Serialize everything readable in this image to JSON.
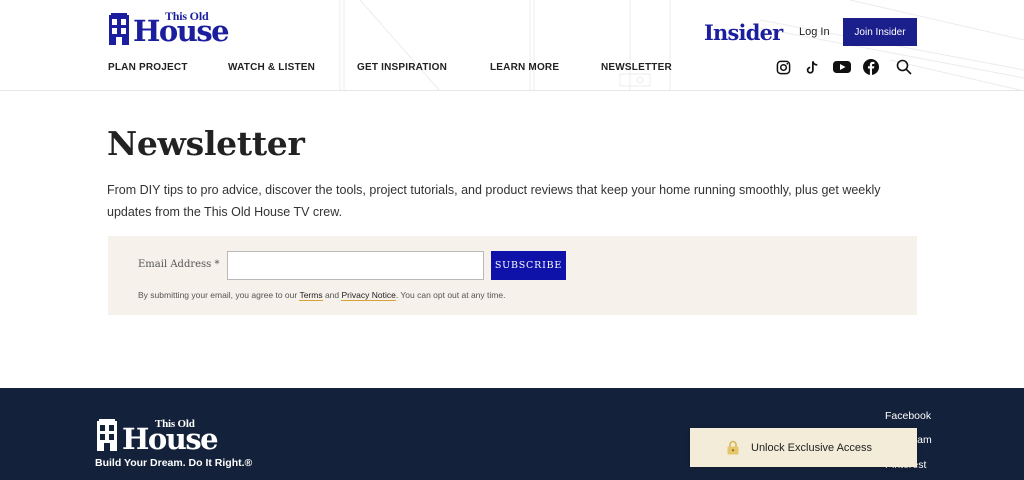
{
  "brand": {
    "logo_small": "This Old",
    "logo_big": "House",
    "insider": "Insider"
  },
  "header": {
    "login_label": "Log In",
    "join_label": "Join Insider"
  },
  "nav": {
    "items": [
      {
        "label": "PLAN PROJECT"
      },
      {
        "label": "WATCH & LISTEN"
      },
      {
        "label": "GET INSPIRATION"
      },
      {
        "label": "LEARN MORE"
      },
      {
        "label": "NEWSLETTER"
      }
    ]
  },
  "social_icons": [
    "instagram-icon",
    "tiktok-icon",
    "youtube-icon",
    "facebook-icon",
    "search-icon"
  ],
  "main": {
    "title": "Newsletter",
    "intro": "From DIY tips to pro advice, discover the tools, project tutorials, and product reviews that keep your home running smoothly, plus get weekly updates from the This Old House TV crew."
  },
  "form": {
    "email_label": "Email Address *",
    "email_value": "",
    "subscribe_label": "SUBSCRIBE",
    "disclaimer_prefix": "By submitting your email, you agree to our ",
    "terms_label": "Terms",
    "and_text": " and ",
    "privacy_label": "Privacy Notice",
    "disclaimer_suffix": ". You can opt out at any time."
  },
  "footer": {
    "tagline": "Build Your Dream. Do It Right.®",
    "links": [
      {
        "label": "Facebook"
      },
      {
        "label": "Instagram"
      },
      {
        "label": "Pinterest"
      }
    ]
  },
  "banner": {
    "label": "Unlock Exclusive Access"
  },
  "colors": {
    "brand_blue": "#1b1f9e",
    "join_button": "#1a1f8c",
    "subscribe_button": "#0f12a8",
    "form_background": "#f6f1ea",
    "footer_background": "#14213a",
    "banner_background": "#f3ecd9",
    "link_underline": "#d9a13a"
  }
}
